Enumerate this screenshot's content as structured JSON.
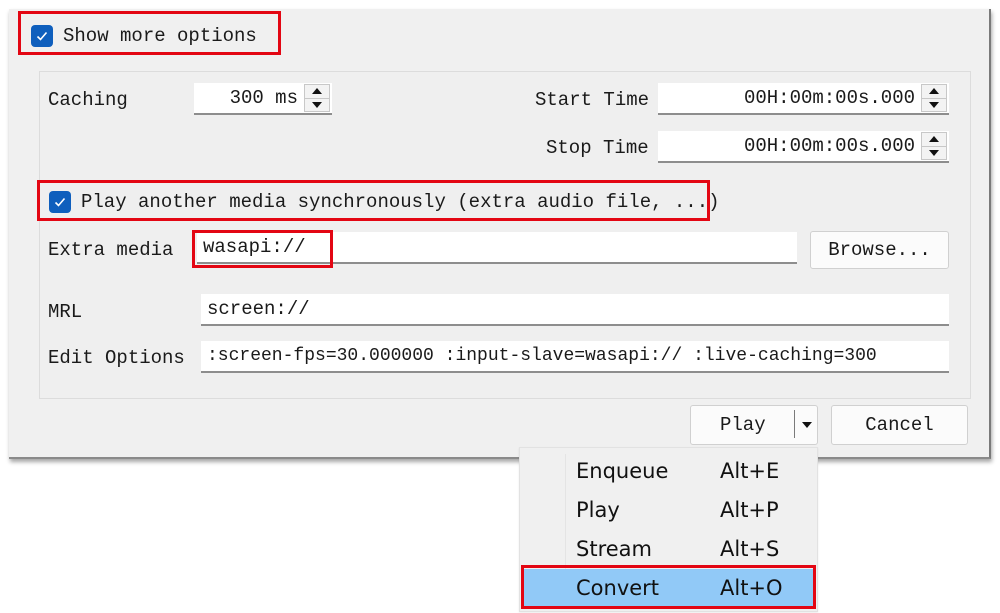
{
  "dialog": {
    "show_more_options": {
      "label": "Show more options",
      "checked": true
    },
    "caching": {
      "label": "Caching",
      "value": "300 ms"
    },
    "start_time": {
      "label": "Start Time",
      "value": "00H:00m:00s.000"
    },
    "stop_time": {
      "label": "Stop Time",
      "value": "00H:00m:00s.000"
    },
    "play_another": {
      "label": "Play another media synchronously (extra audio file, ...)",
      "checked": true
    },
    "extra_media": {
      "label": "Extra media",
      "value": "wasapi://",
      "browse_label": "Browse..."
    },
    "mrl": {
      "label": "MRL",
      "value": "screen://"
    },
    "edit_options": {
      "label": "Edit Options",
      "value": " :screen-fps=30.000000 :input-slave=wasapi:// :live-caching=300"
    },
    "buttons": {
      "play_label": "Play",
      "cancel_label": "Cancel"
    }
  },
  "dropdown_menu": {
    "items": [
      {
        "label": "Enqueue",
        "shortcut": "Alt+E",
        "highlighted": false
      },
      {
        "label": "Play",
        "shortcut": "Alt+P",
        "highlighted": false
      },
      {
        "label": "Stream",
        "shortcut": "Alt+S",
        "highlighted": false
      },
      {
        "label": "Convert",
        "shortcut": "Alt+O",
        "highlighted": true
      }
    ]
  },
  "colors": {
    "accent_checkbox": "#0f5fbd",
    "annotation_red": "#e30613",
    "menu_highlight": "#91c9f7"
  }
}
